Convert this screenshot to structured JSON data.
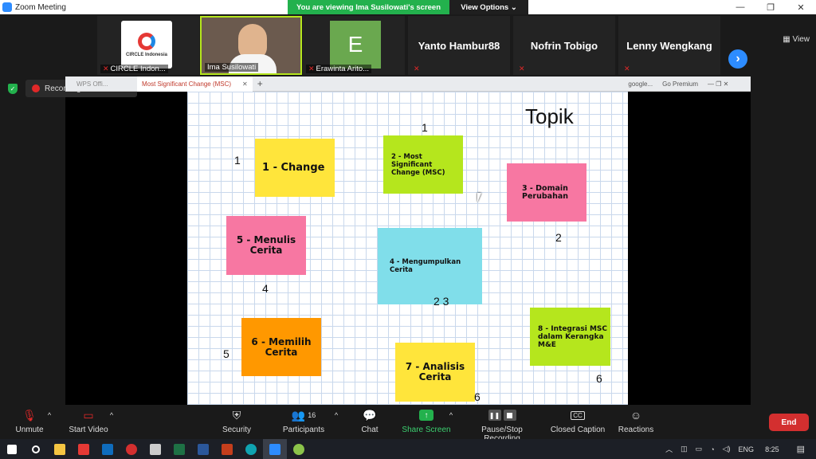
{
  "window": {
    "title": "Zoom Meeting",
    "min": "—",
    "restore": "❐",
    "close": "✕"
  },
  "banner": {
    "message": "You are viewing Ima Susilowati's screen",
    "options": "View Options ⌄"
  },
  "gallery": {
    "view_label": "View",
    "participants": [
      {
        "name": "CIRCLE Indon...",
        "big": "",
        "logo": "CIRCLE Indonesia"
      },
      {
        "name": "Ima Susilowati",
        "big": ""
      },
      {
        "name": "Erawinta Arito...",
        "big": "E"
      },
      {
        "name": "",
        "big": "Yanto Hambur88"
      },
      {
        "name": "",
        "big": "Nofrin Tobigo"
      },
      {
        "name": "",
        "big": "Lenny Wengkang"
      }
    ],
    "next": "›"
  },
  "recording": {
    "label": "Recording..."
  },
  "wps": {
    "tab1": "WPS Offi...",
    "tab2": "Most Significant Change (MSC)",
    "add": "+",
    "tab3": "google...",
    "premium": "Go Premium"
  },
  "slide": {
    "title": "Topik",
    "notes": [
      {
        "text": "1 - Change",
        "color": "#ffe53b"
      },
      {
        "text": "2 - Most Significant Change (MSC)",
        "color": "#b5e61d"
      },
      {
        "text": "3 - Domain Perubahan",
        "color": "#f777a2"
      },
      {
        "text": "4 - Mengumpulkan Cerita",
        "color": "#80deea"
      },
      {
        "text": "5 - Menulis Cerita",
        "color": "#f777a2"
      },
      {
        "text": "6 - Memilih Cerita",
        "color": "#ff9800"
      },
      {
        "text": "7 - Analisis Cerita",
        "color": "#ffe53b"
      },
      {
        "text": "8 - Integrasi MSC dalam Kerangka M&E",
        "color": "#b5e61d"
      }
    ],
    "numbers": [
      "1",
      "1",
      "2",
      "2 3",
      "4",
      "5",
      "6",
      "6"
    ]
  },
  "toolbar": {
    "unmute": "Unmute",
    "start_video": "Start Video",
    "security": "Security",
    "participants": "Participants",
    "participant_count": "16",
    "chat": "Chat",
    "share_screen": "Share Screen",
    "pause_recording": "Pause/Stop Recording",
    "closed_caption": "Closed Caption",
    "cc_icon": "CC",
    "reactions": "Reactions",
    "end": "End"
  },
  "taskbar": {
    "lang": "ENG",
    "time": "8:25"
  },
  "colors": {
    "accent": "#2d8cff",
    "share_green": "#23b14d",
    "end_red": "#d32f2f"
  }
}
